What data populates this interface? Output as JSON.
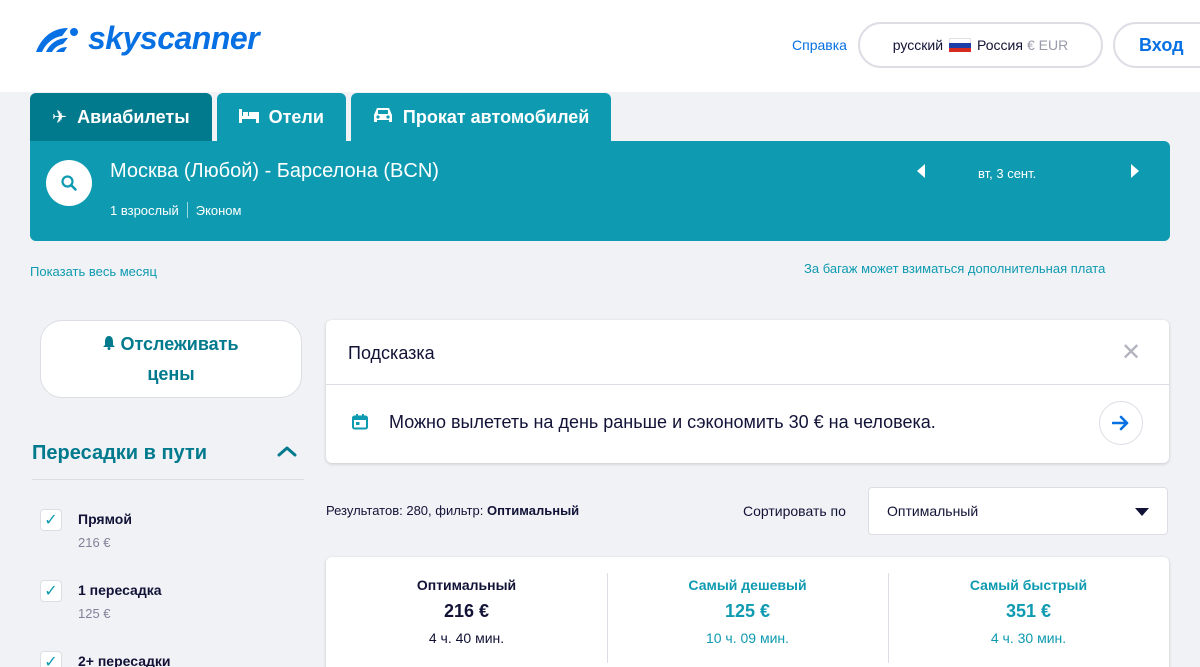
{
  "header": {
    "logo_text": "skyscanner",
    "help_link": "Справка",
    "locale": {
      "language": "русский",
      "country": "Россия",
      "currency": "€ EUR"
    },
    "login_label": "Вход",
    "brand_color": "#0770e3"
  },
  "tabs": [
    {
      "label": "Авиабилеты",
      "icon": "plane-icon",
      "active": true
    },
    {
      "label": "Отели",
      "icon": "bed-icon",
      "active": false
    },
    {
      "label": "Прокат автомобилей",
      "icon": "car-icon",
      "active": false
    }
  ],
  "search": {
    "route": "Москва (Любой) - Барселона (BCN)",
    "passengers": "1 взрослый",
    "cabin_class": "Эконом",
    "date": "вт, 3 сент.",
    "icon": "search-icon",
    "panel_color": "#0e9ab0"
  },
  "links": {
    "show_month": "Показать весь месяц",
    "baggage_note": "За багаж может взиматься дополнительная плата"
  },
  "sidebar": {
    "track_prices_line1": "Отслеживать",
    "track_prices_line2": "цены",
    "track_icon": "bell-icon",
    "stops_title": "Пересадки в пути",
    "stops": [
      {
        "label": "Прямой",
        "price": "216 €",
        "checked": true
      },
      {
        "label": "1 пересадка",
        "price": "125 €",
        "checked": true
      },
      {
        "label": "2+ пересадки",
        "price": "",
        "checked": true
      }
    ]
  },
  "hint": {
    "title": "Подсказка",
    "message": "Можно вылететь на день раньше и сэкономить 30 € на человека.",
    "icon": "calendar-icon"
  },
  "results": {
    "summary_prefix": "Результатов: 280, фильтр: ",
    "summary_filter": "Оптимальный",
    "sort_label": "Сортировать по",
    "sort_value": "Оптимальный"
  },
  "sort_tabs": [
    {
      "name": "Оптимальный",
      "price": "216 €",
      "duration": "4 ч. 40 мин.",
      "selected": true
    },
    {
      "name": "Самый дешевый",
      "price": "125 €",
      "duration": "10 ч. 09 мин.",
      "selected": false
    },
    {
      "name": "Самый быстрый",
      "price": "351 €",
      "duration": "4 ч. 30 мин.",
      "selected": false
    }
  ]
}
